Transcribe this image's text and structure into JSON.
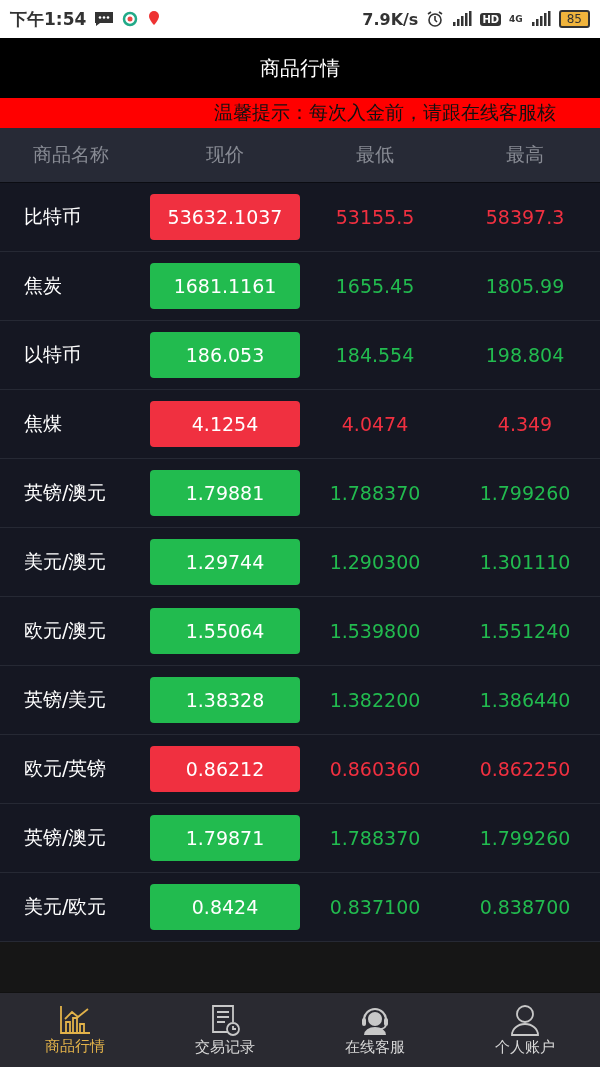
{
  "status_bar": {
    "time": "下午1:54",
    "speed": "7.9K/s",
    "network": "4G",
    "hd": "HD",
    "battery": "85"
  },
  "title": "商品行情",
  "ticker": "温馨提示：每次入金前，请跟在线客服核",
  "table": {
    "columns": [
      "商品名称",
      "现价",
      "最低",
      "最高"
    ],
    "rows": [
      {
        "name": "比特币",
        "price": "53632.1037",
        "low": "53155.5",
        "high": "58397.3",
        "kind": "falling"
      },
      {
        "name": "焦炭",
        "price": "1681.1161",
        "low": "1655.45",
        "high": "1805.99",
        "kind": "rising"
      },
      {
        "name": "以特币",
        "price": "186.053",
        "low": "184.554",
        "high": "198.804",
        "kind": "rising"
      },
      {
        "name": "焦煤",
        "price": "4.1254",
        "low": "4.0474",
        "high": "4.349",
        "kind": "falling"
      },
      {
        "name": "英镑/澳元",
        "price": "1.79881",
        "low": "1.788370",
        "high": "1.799260",
        "kind": "rising"
      },
      {
        "name": "美元/澳元",
        "price": "1.29744",
        "low": "1.290300",
        "high": "1.301110",
        "kind": "rising"
      },
      {
        "name": "欧元/澳元",
        "price": "1.55064",
        "low": "1.539800",
        "high": "1.551240",
        "kind": "rising"
      },
      {
        "name": "英镑/美元",
        "price": "1.38328",
        "low": "1.382200",
        "high": "1.386440",
        "kind": "rising"
      },
      {
        "name": "欧元/英镑",
        "price": "0.86212",
        "low": "0.860360",
        "high": "0.862250",
        "kind": "falling"
      },
      {
        "name": "英镑/澳元",
        "price": "1.79871",
        "low": "1.788370",
        "high": "1.799260",
        "kind": "rising"
      },
      {
        "name": "美元/欧元",
        "price": "0.8424",
        "low": "0.837100",
        "high": "0.838700",
        "kind": "rising"
      }
    ]
  },
  "nav": [
    {
      "label": "商品行情",
      "kind": "chart",
      "selected": true
    },
    {
      "label": "交易记录",
      "kind": "records",
      "selected": false
    },
    {
      "label": "在线客服",
      "kind": "support",
      "selected": false
    },
    {
      "label": "个人账户",
      "kind": "account",
      "selected": false
    }
  ]
}
